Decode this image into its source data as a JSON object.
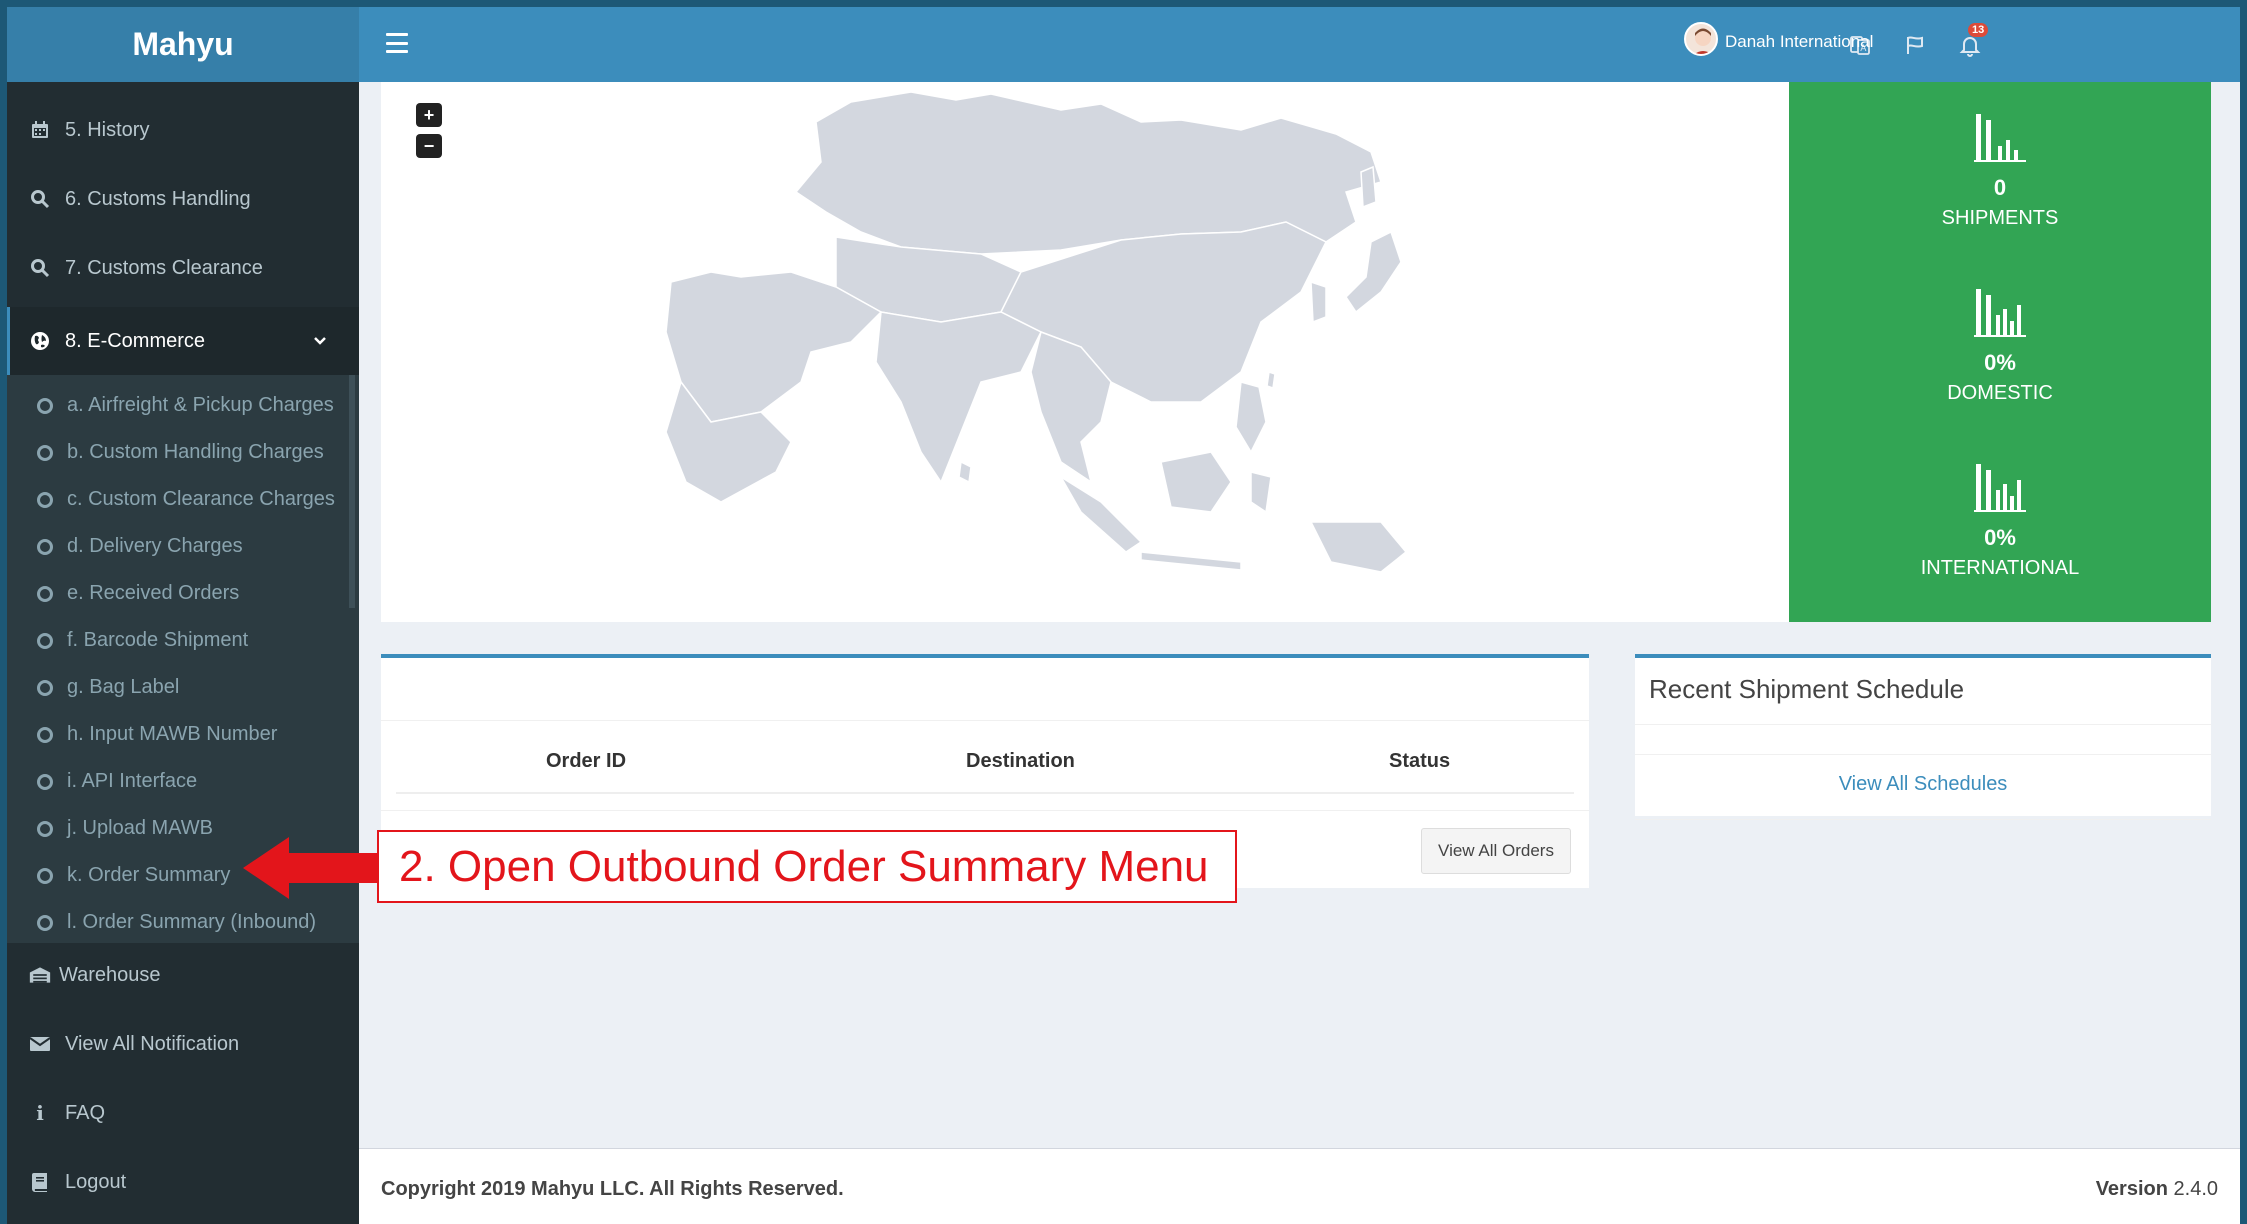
{
  "header": {
    "brand": "Mahyu",
    "user_name": "Danah International",
    "notification_count": "13",
    "icons": [
      "translate-icon",
      "flag-icon",
      "bell-icon",
      "hamburger-icon"
    ]
  },
  "sidebar": {
    "items": [
      {
        "label": "5. History",
        "icon": "calendar-icon"
      },
      {
        "label": "6. Customs Handling",
        "icon": "search-icon"
      },
      {
        "label": "7. Customs Clearance",
        "icon": "search-icon"
      },
      {
        "label": "8. E-Commerce",
        "icon": "globe-icon",
        "expanded": true
      }
    ],
    "submenu": [
      "a. Airfreight & Pickup Charges",
      "b. Custom Handling Charges",
      "c. Custom Clearance Charges",
      "d. Delivery Charges",
      "e. Received Orders",
      "f. Barcode Shipment",
      "g. Bag Label",
      "h. Input MAWB Number",
      "i. API Interface",
      "j. Upload MAWB",
      "k. Order Summary",
      "l. Order Summary (Inbound)"
    ],
    "bottom_items": [
      {
        "label": "Warehouse",
        "icon": "warehouse-icon"
      },
      {
        "label": "View All Notification",
        "icon": "envelope-icon"
      },
      {
        "label": "FAQ",
        "icon": "info-icon"
      },
      {
        "label": "Logout",
        "icon": "book-icon"
      }
    ]
  },
  "map": {
    "zoom_in": "+",
    "zoom_out": "−"
  },
  "stats": [
    {
      "value": "0",
      "label": "SHIPMENTS"
    },
    {
      "value": "0%",
      "label": "DOMESTIC"
    },
    {
      "value": "0%",
      "label": "INTERNATIONAL"
    }
  ],
  "orders": {
    "columns": [
      "Order ID",
      "Destination",
      "Status"
    ],
    "view_all_button": "View All Orders"
  },
  "schedule": {
    "title": "Recent Shipment Schedule",
    "view_all_link": "View All Schedules"
  },
  "footer": {
    "copyright": "Copyright 2019 Mahyu LLC. All Rights Reserved.",
    "version_label": "Version",
    "version_number": "2.4.0"
  },
  "annotation": {
    "text": "2. Open Outbound Order Summary Menu"
  },
  "colors": {
    "header": "#3c8dbc",
    "logo_bg": "#367fa9",
    "sidebar": "#222d32",
    "stats_bg": "#32a554",
    "annotation": "#e3151b"
  }
}
